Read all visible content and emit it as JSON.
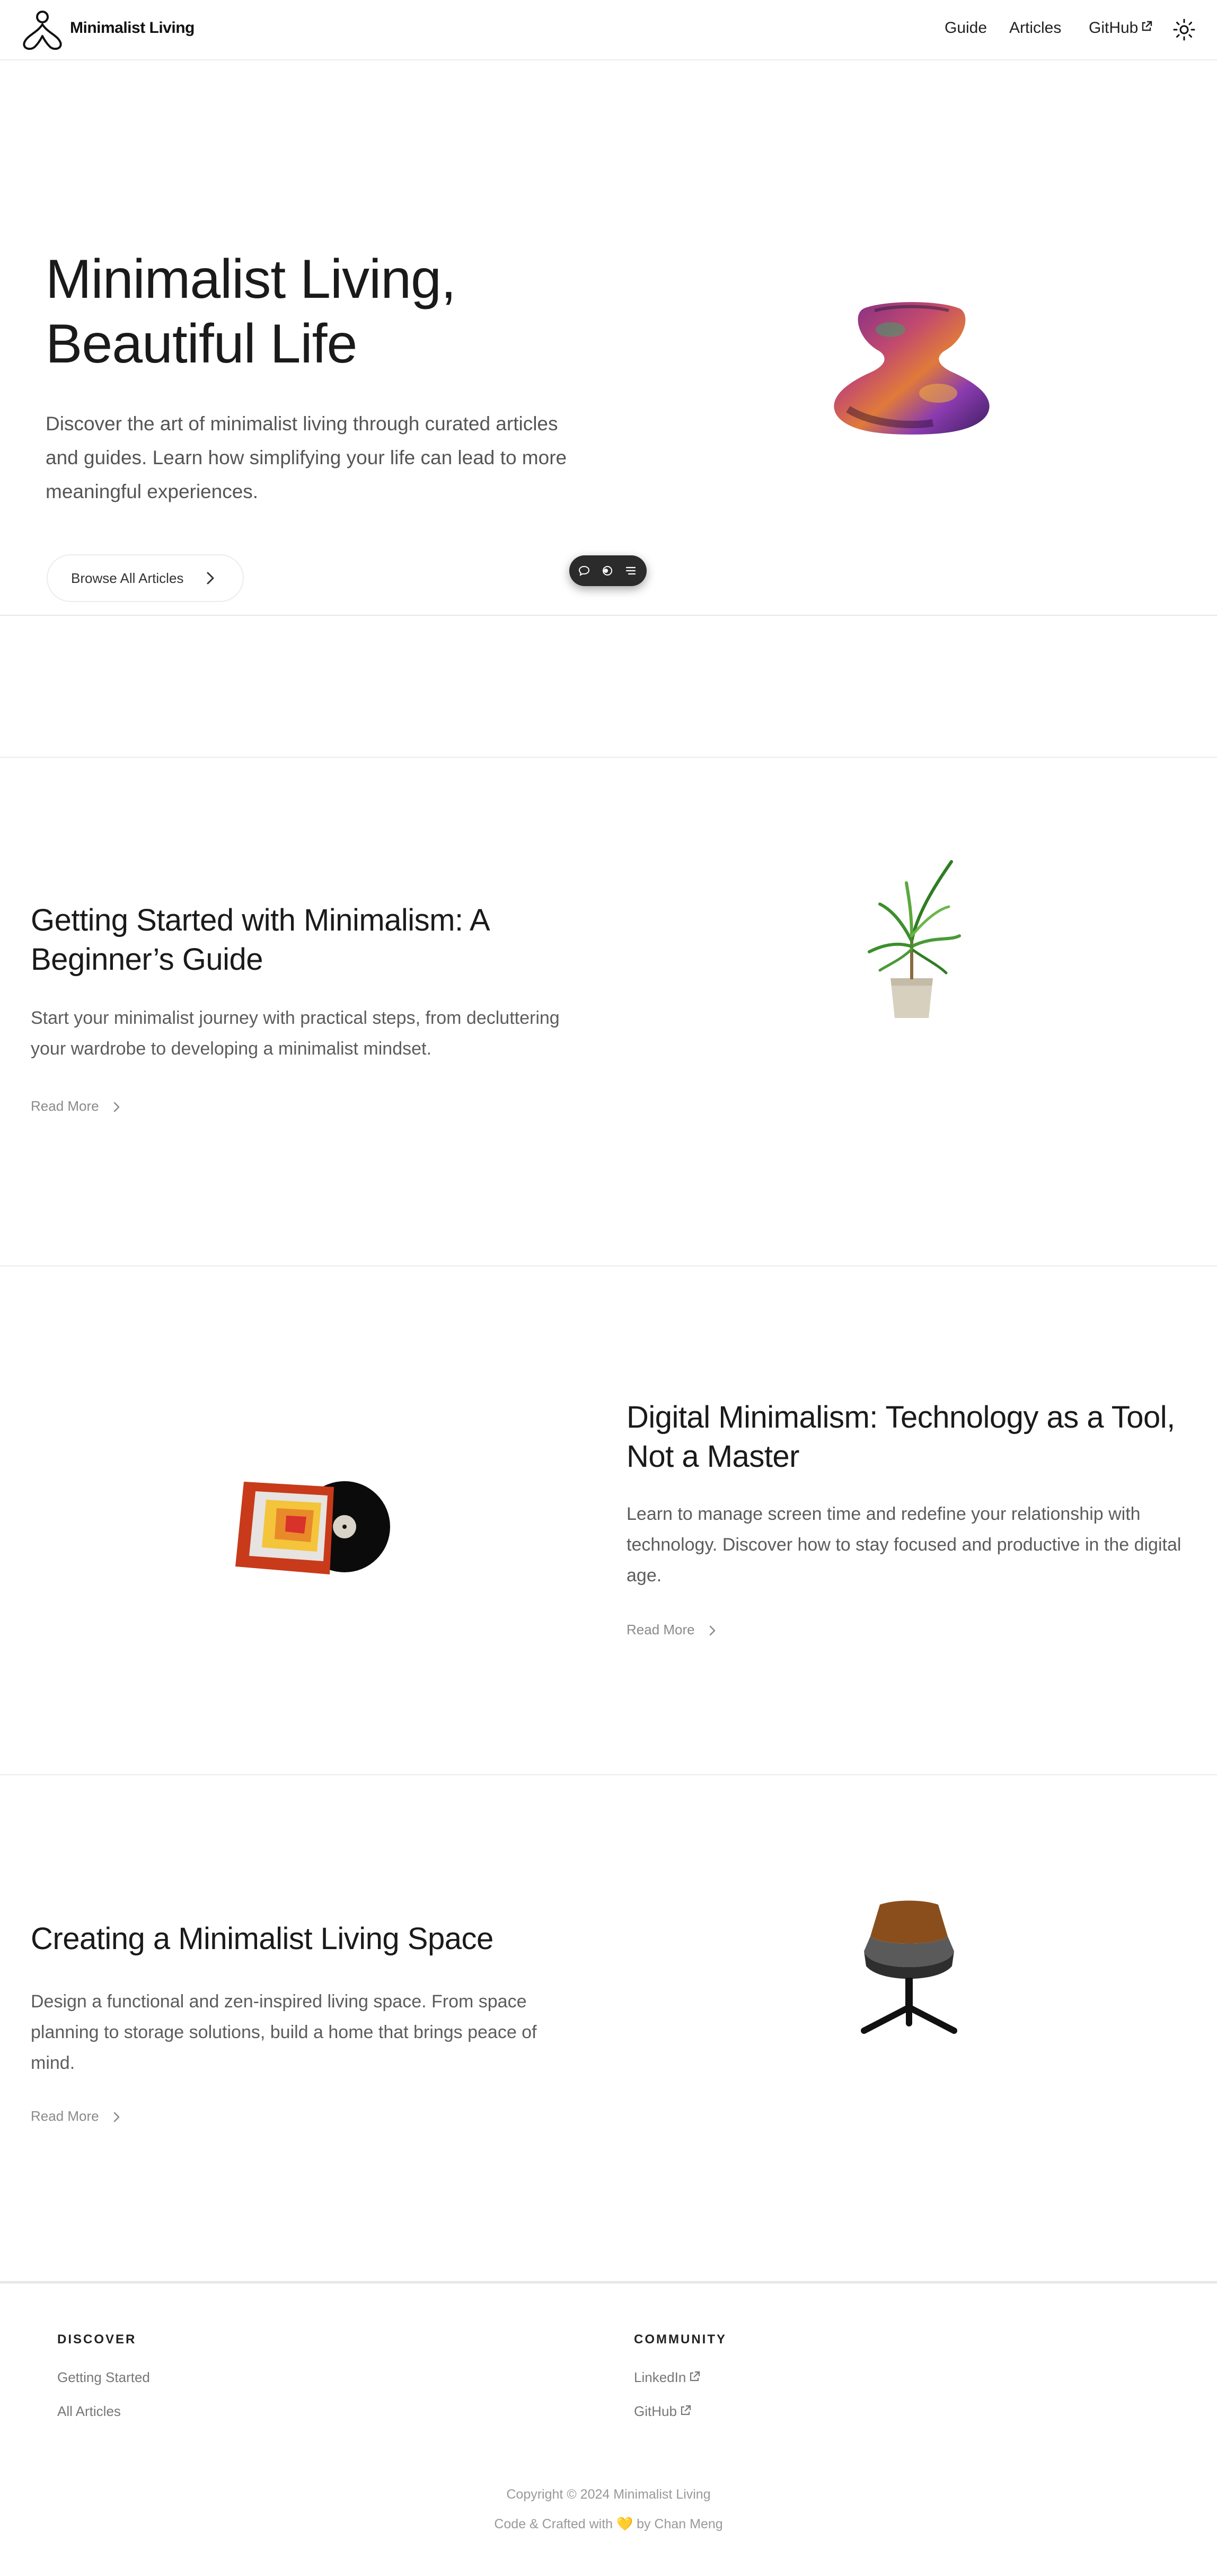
{
  "header": {
    "brand": "Minimalist Living",
    "nav": [
      {
        "label": "Guide"
      },
      {
        "label": "Articles"
      },
      {
        "label": "GitHub"
      }
    ],
    "theme_icon": "sun-icon",
    "logo_icon": "lotus-meditation-icon"
  },
  "hero": {
    "title_line1": "Minimalist Living,",
    "title_line2": "Beautiful Life",
    "description": "Discover the art of minimalist living through curated articles and guides. Learn how simplifying your life can lead to more meaningful experiences.",
    "button_label": "Browse All Articles",
    "image": "colorful-vase-3d-model",
    "toolbar_icons": [
      "comment-icon",
      "toggle-icon",
      "menu-icon"
    ]
  },
  "articles": [
    {
      "title": "Getting Started with Minimalism: A Beginner’s Guide",
      "description": "Start your minimalist journey with practical steps, from decluttering your wardrobe to developing a minimalist mindset.",
      "read_more": "Read More",
      "image": "potted-plant-3d-model"
    },
    {
      "title": "Digital Minimalism: Technology as a Tool, Not a Master",
      "description": "Learn to manage screen time and redefine your relationship with technology. Discover how to stay focused and productive in the digital age.",
      "read_more": "Read More",
      "image": "vinyl-record-3d-model"
    },
    {
      "title": "Creating a Minimalist Living Space",
      "description": "Design a functional and zen-inspired living space. From space planning to storage solutions, build a home that brings peace of mind.",
      "read_more": "Read More",
      "image": "lounge-chair-3d-model"
    }
  ],
  "footer": {
    "discover_heading": "DISCOVER",
    "discover_links": [
      "Getting Started",
      "All Articles"
    ],
    "community_heading": "COMMUNITY",
    "community_links": [
      "LinkedIn",
      "GitHub"
    ],
    "copyright": "Copyright © 2024 Minimalist Living",
    "credit": "Code & Crafted with 💛 by Chan Meng"
  },
  "colors": {
    "text": "#1a1a1a",
    "muted": "#5c5c5c",
    "link_muted": "#8a8a8a",
    "border": "#ececec",
    "pill_bg": "#2b2b2b"
  }
}
